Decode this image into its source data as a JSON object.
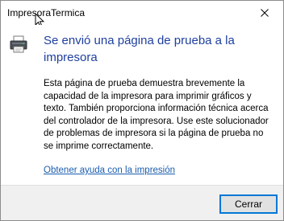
{
  "window": {
    "title": "ImpresoraTermica",
    "close_icon": "close-icon"
  },
  "dialog": {
    "icon": "printer-icon",
    "heading": "Se envió una página de prueba a la impresora",
    "body": "Esta página de prueba demuestra brevemente la capacidad de la impresora para imprimir gráficos y texto. También proporciona información técnica acerca del controlador de la impresora. Use este solucionador de problemas de impresora si la página de prueba no se imprime correctamente.",
    "help_link": "Obtener ayuda con la impresión"
  },
  "footer": {
    "close_label": "Cerrar"
  },
  "colors": {
    "heading": "#1e3f9f",
    "link": "#1a5db0",
    "footer_bg": "#f0f0f0",
    "button_focus": "#0078d7"
  }
}
